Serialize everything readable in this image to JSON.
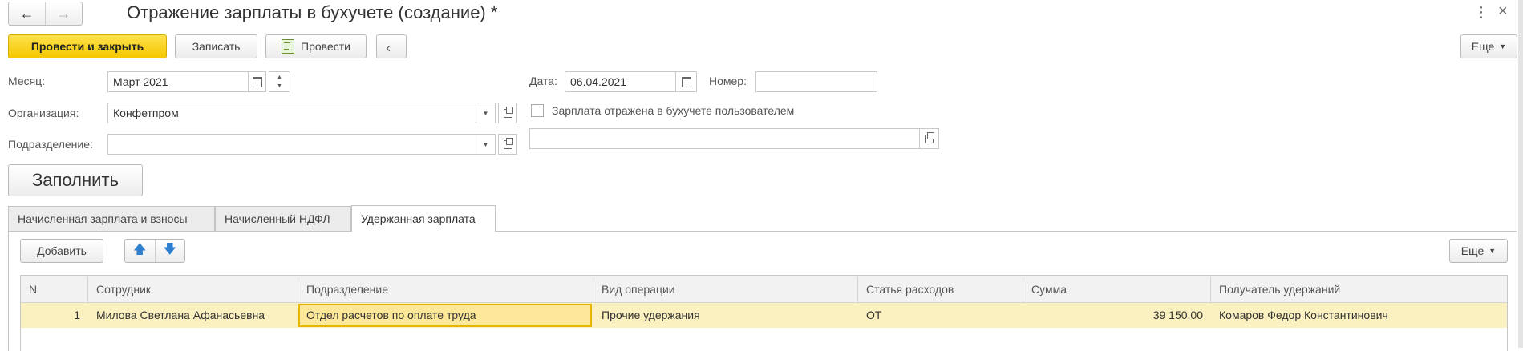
{
  "window": {
    "title": "Отражение зарплаты в бухучете (создание) *"
  },
  "toolbar": {
    "post_close": "Провести и закрыть",
    "save": "Записать",
    "post": "Провести",
    "more": "Еще"
  },
  "form": {
    "month_label": "Месяц:",
    "month_value": "Март 2021",
    "date_label": "Дата:",
    "date_value": "06.04.2021",
    "number_label": "Номер:",
    "number_value": "",
    "org_label": "Организация:",
    "org_value": "Конфетпром",
    "checkbox_label": "Зарплата отражена в бухучете пользователем",
    "dept_label": "Подразделение:",
    "dept_value": "",
    "fill_button": "Заполнить"
  },
  "tabs": [
    {
      "label": "Начисленная зарплата и взносы"
    },
    {
      "label": "Начисленный НДФЛ"
    },
    {
      "label": "Удержанная зарплата"
    }
  ],
  "table_toolbar": {
    "add": "Добавить",
    "more": "Еще"
  },
  "table": {
    "columns": [
      "N",
      "Сотрудник",
      "Подразделение",
      "Вид операции",
      "Статья расходов",
      "Сумма",
      "Получатель удержаний"
    ],
    "rows": [
      [
        "1",
        "Милова Светлана Афанасьевна",
        "Отдел расчетов по оплате труда",
        "Прочие удержания",
        "ОТ",
        "39 150,00",
        "Комаров Федор Константинович"
      ]
    ]
  },
  "colors": {
    "primary": "#f5c800",
    "selected_row": "#fbf0c0",
    "active_cell_border": "#e8b400"
  }
}
